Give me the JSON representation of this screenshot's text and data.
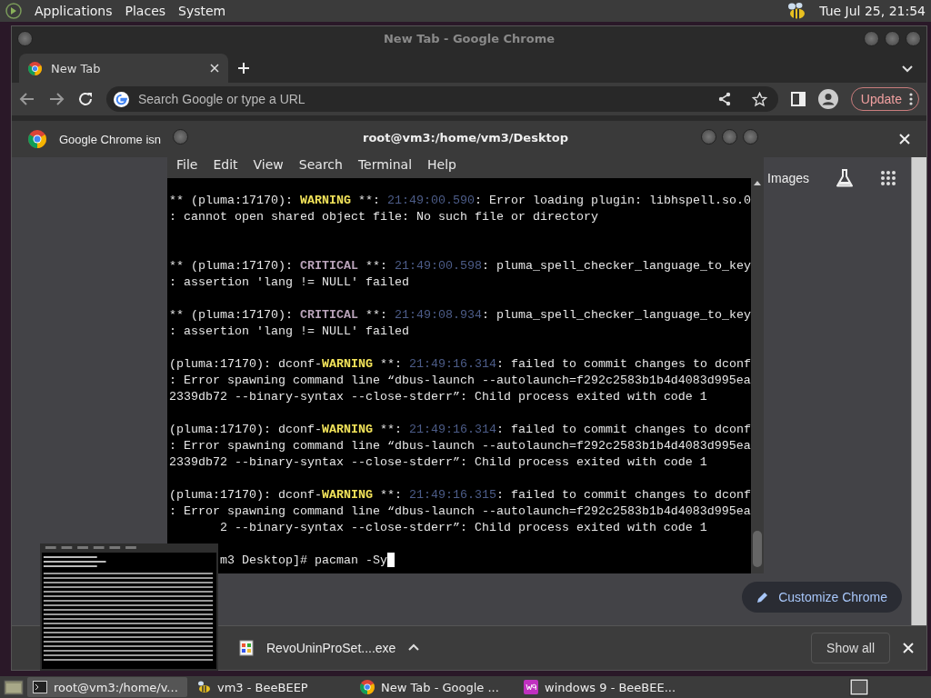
{
  "top_panel": {
    "menus": [
      "Applications",
      "Places",
      "System"
    ],
    "clock": "Tue Jul 25, 21:54"
  },
  "chrome": {
    "title": "New Tab - Google Chrome",
    "tabs": [
      {
        "label": "New Tab",
        "selected": true
      }
    ],
    "omnibox": {
      "placeholder": "Search Google or type a URL"
    },
    "update_button": "Update",
    "infobar": "Google Chrome isn",
    "links": [
      "Images"
    ],
    "customize_button": "Customize Chrome",
    "downloads": [
      {
        "name": "RevoUninProSet....exe"
      }
    ],
    "show_all": "Show all"
  },
  "terminal": {
    "title": "root@vm3:/home/vm3/Desktop",
    "menu": [
      "File",
      "Edit",
      "View",
      "Search",
      "Terminal",
      "Help"
    ],
    "blocks": [
      {
        "lines": [
          {
            "segments": [
              {
                "kind": "plain",
                "text": "** (pluma:17170): "
              },
              {
                "kind": "warning",
                "text": "WARNING"
              },
              {
                "kind": "plain",
                "text": " **: "
              },
              {
                "kind": "timestamp",
                "text": "21:49:00.590"
              },
              {
                "kind": "plain",
                "text": ": Error loading plugin: libhspell.so.0"
              }
            ]
          },
          {
            "segments": [
              {
                "kind": "plain",
                "text": ": cannot open shared object file: No such file or directory"
              }
            ]
          }
        ]
      },
      {
        "lines": [
          {
            "segments": [
              {
                "kind": "plain",
                "text": "** (pluma:17170): "
              },
              {
                "kind": "critical",
                "text": "CRITICAL"
              },
              {
                "kind": "plain",
                "text": " **: "
              },
              {
                "kind": "timestamp",
                "text": "21:49:00.598"
              },
              {
                "kind": "plain",
                "text": ": pluma_spell_checker_language_to_key"
              }
            ]
          },
          {
            "segments": [
              {
                "kind": "plain",
                "text": ": assertion 'lang != NULL' failed"
              }
            ]
          }
        ]
      },
      {
        "lines": [
          {
            "segments": [
              {
                "kind": "plain",
                "text": "** (pluma:17170): "
              },
              {
                "kind": "critical",
                "text": "CRITICAL"
              },
              {
                "kind": "plain",
                "text": " **: "
              },
              {
                "kind": "timestamp",
                "text": "21:49:08.934"
              },
              {
                "kind": "plain",
                "text": ": pluma_spell_checker_language_to_key"
              }
            ]
          },
          {
            "segments": [
              {
                "kind": "plain",
                "text": ": assertion 'lang != NULL' failed"
              }
            ]
          }
        ]
      },
      {
        "lines": [
          {
            "segments": [
              {
                "kind": "plain",
                "text": "(pluma:17170): dconf-"
              },
              {
                "kind": "warning",
                "text": "WARNING"
              },
              {
                "kind": "plain",
                "text": " **: "
              },
              {
                "kind": "timestamp",
                "text": "21:49:16.314"
              },
              {
                "kind": "plain",
                "text": ": failed to commit changes to dconf"
              }
            ]
          },
          {
            "segments": [
              {
                "kind": "plain",
                "text": ": Error spawning command line “dbus-launch --autolaunch=f292c2583b1b4d4083d995ea"
              }
            ]
          },
          {
            "segments": [
              {
                "kind": "plain",
                "text": "2339db72 --binary-syntax --close-stderr”: Child process exited with code 1"
              }
            ]
          }
        ]
      },
      {
        "lines": [
          {
            "segments": [
              {
                "kind": "plain",
                "text": "(pluma:17170): dconf-"
              },
              {
                "kind": "warning",
                "text": "WARNING"
              },
              {
                "kind": "plain",
                "text": " **: "
              },
              {
                "kind": "timestamp",
                "text": "21:49:16.314"
              },
              {
                "kind": "plain",
                "text": ": failed to commit changes to dconf"
              }
            ]
          },
          {
            "segments": [
              {
                "kind": "plain",
                "text": ": Error spawning command line “dbus-launch --autolaunch=f292c2583b1b4d4083d995ea"
              }
            ]
          },
          {
            "segments": [
              {
                "kind": "plain",
                "text": "2339db72 --binary-syntax --close-stderr”: Child process exited with code 1"
              }
            ]
          }
        ]
      },
      {
        "lines": [
          {
            "segments": [
              {
                "kind": "plain",
                "text": "(pluma:17170): dconf-"
              },
              {
                "kind": "warning",
                "text": "WARNING"
              },
              {
                "kind": "plain",
                "text": " **: "
              },
              {
                "kind": "timestamp",
                "text": "21:49:16.315"
              },
              {
                "kind": "plain",
                "text": ": failed to commit changes to dconf"
              }
            ]
          },
          {
            "segments": [
              {
                "kind": "plain",
                "text": ": Error spawning command line “dbus-launch --autolaunch=f292c2583b1b4d4083d995ea"
              }
            ]
          },
          {
            "covered": true,
            "segments": [
              {
                "kind": "plain",
                "text": "2 --binary-syntax --close-stderr”: Child process exited with code 1"
              }
            ]
          }
        ]
      }
    ],
    "prompt": {
      "covered": true,
      "text": "m3 Desktop]# pacman -Sy"
    }
  },
  "taskbar": {
    "items": [
      {
        "kind": "terminal",
        "label": "root@vm3:/home/v...",
        "selected": true
      },
      {
        "kind": "bee",
        "label": "vm3 - BeeBEEP",
        "selected": false
      },
      {
        "kind": "chrome",
        "label": "New Tab - Google ...",
        "selected": false
      },
      {
        "kind": "w9",
        "label": "windows 9 - BeeBEE...",
        "selected": false
      }
    ]
  }
}
